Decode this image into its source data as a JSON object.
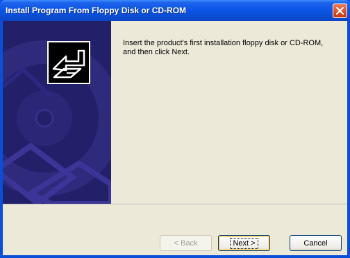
{
  "window": {
    "title": "Install Program From Floppy Disk or CD-ROM"
  },
  "message": {
    "line1": "Insert the product's first installation floppy disk or CD-ROM,",
    "line2": "and then click Next."
  },
  "buttons": {
    "back_label": "< Back",
    "next_label": "Next >",
    "cancel_label": "Cancel",
    "back_enabled": false,
    "default_button": "next"
  },
  "icons": {
    "close": "close-icon",
    "install": "install-program-icon",
    "side_art": "cd-rom-artwork"
  },
  "colors": {
    "titlebar": "#0a4fd8",
    "side_panel": "#23206a",
    "dialog_face": "#ece9d8",
    "close_button": "#d94b23"
  }
}
